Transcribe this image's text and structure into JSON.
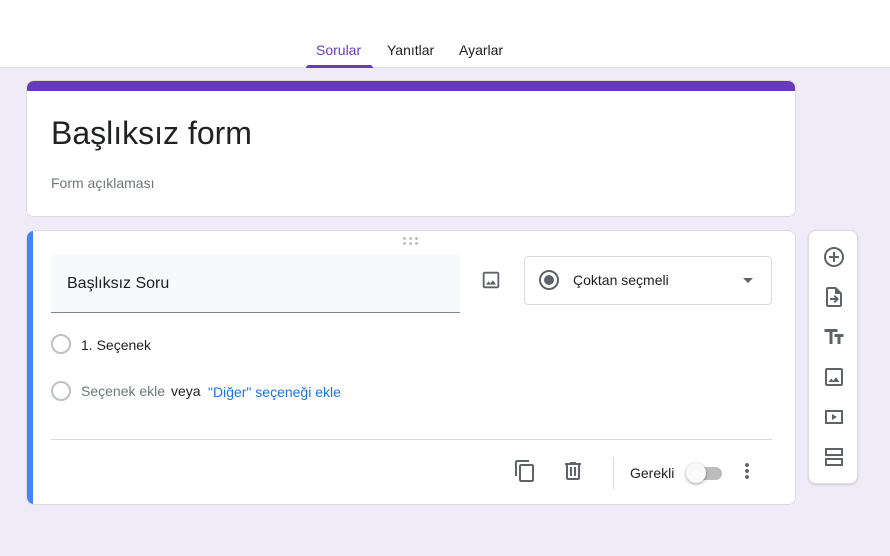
{
  "tabs": [
    {
      "label": "Sorular",
      "active": true
    },
    {
      "label": "Yanıtlar",
      "active": false
    },
    {
      "label": "Ayarlar",
      "active": false
    }
  ],
  "form": {
    "title": "Başlıksız form",
    "description_placeholder": "Form açıklaması",
    "accent_color": "#673ab7"
  },
  "question": {
    "title": "Başlıksız Soru",
    "type": "Çoktan seçmeli",
    "options": [
      "1. Seçenek"
    ],
    "add_option_label": "Seçenek ekle",
    "or_label": "veya",
    "add_other_label": "\"Diğer\" seçeneği ekle",
    "required_label": "Gerekli",
    "required": false,
    "accent_color": "#4285f4"
  },
  "icons": {
    "question_image": "image-icon",
    "type_selector": "radio-button-icon",
    "duplicate": "copy-icon",
    "delete": "trash-icon",
    "more": "more-vert-icon"
  },
  "side_toolbar": [
    {
      "name": "add-question-icon"
    },
    {
      "name": "import-questions-icon"
    },
    {
      "name": "add-title-description-icon"
    },
    {
      "name": "add-image-icon"
    },
    {
      "name": "add-video-icon"
    },
    {
      "name": "add-section-icon"
    }
  ]
}
